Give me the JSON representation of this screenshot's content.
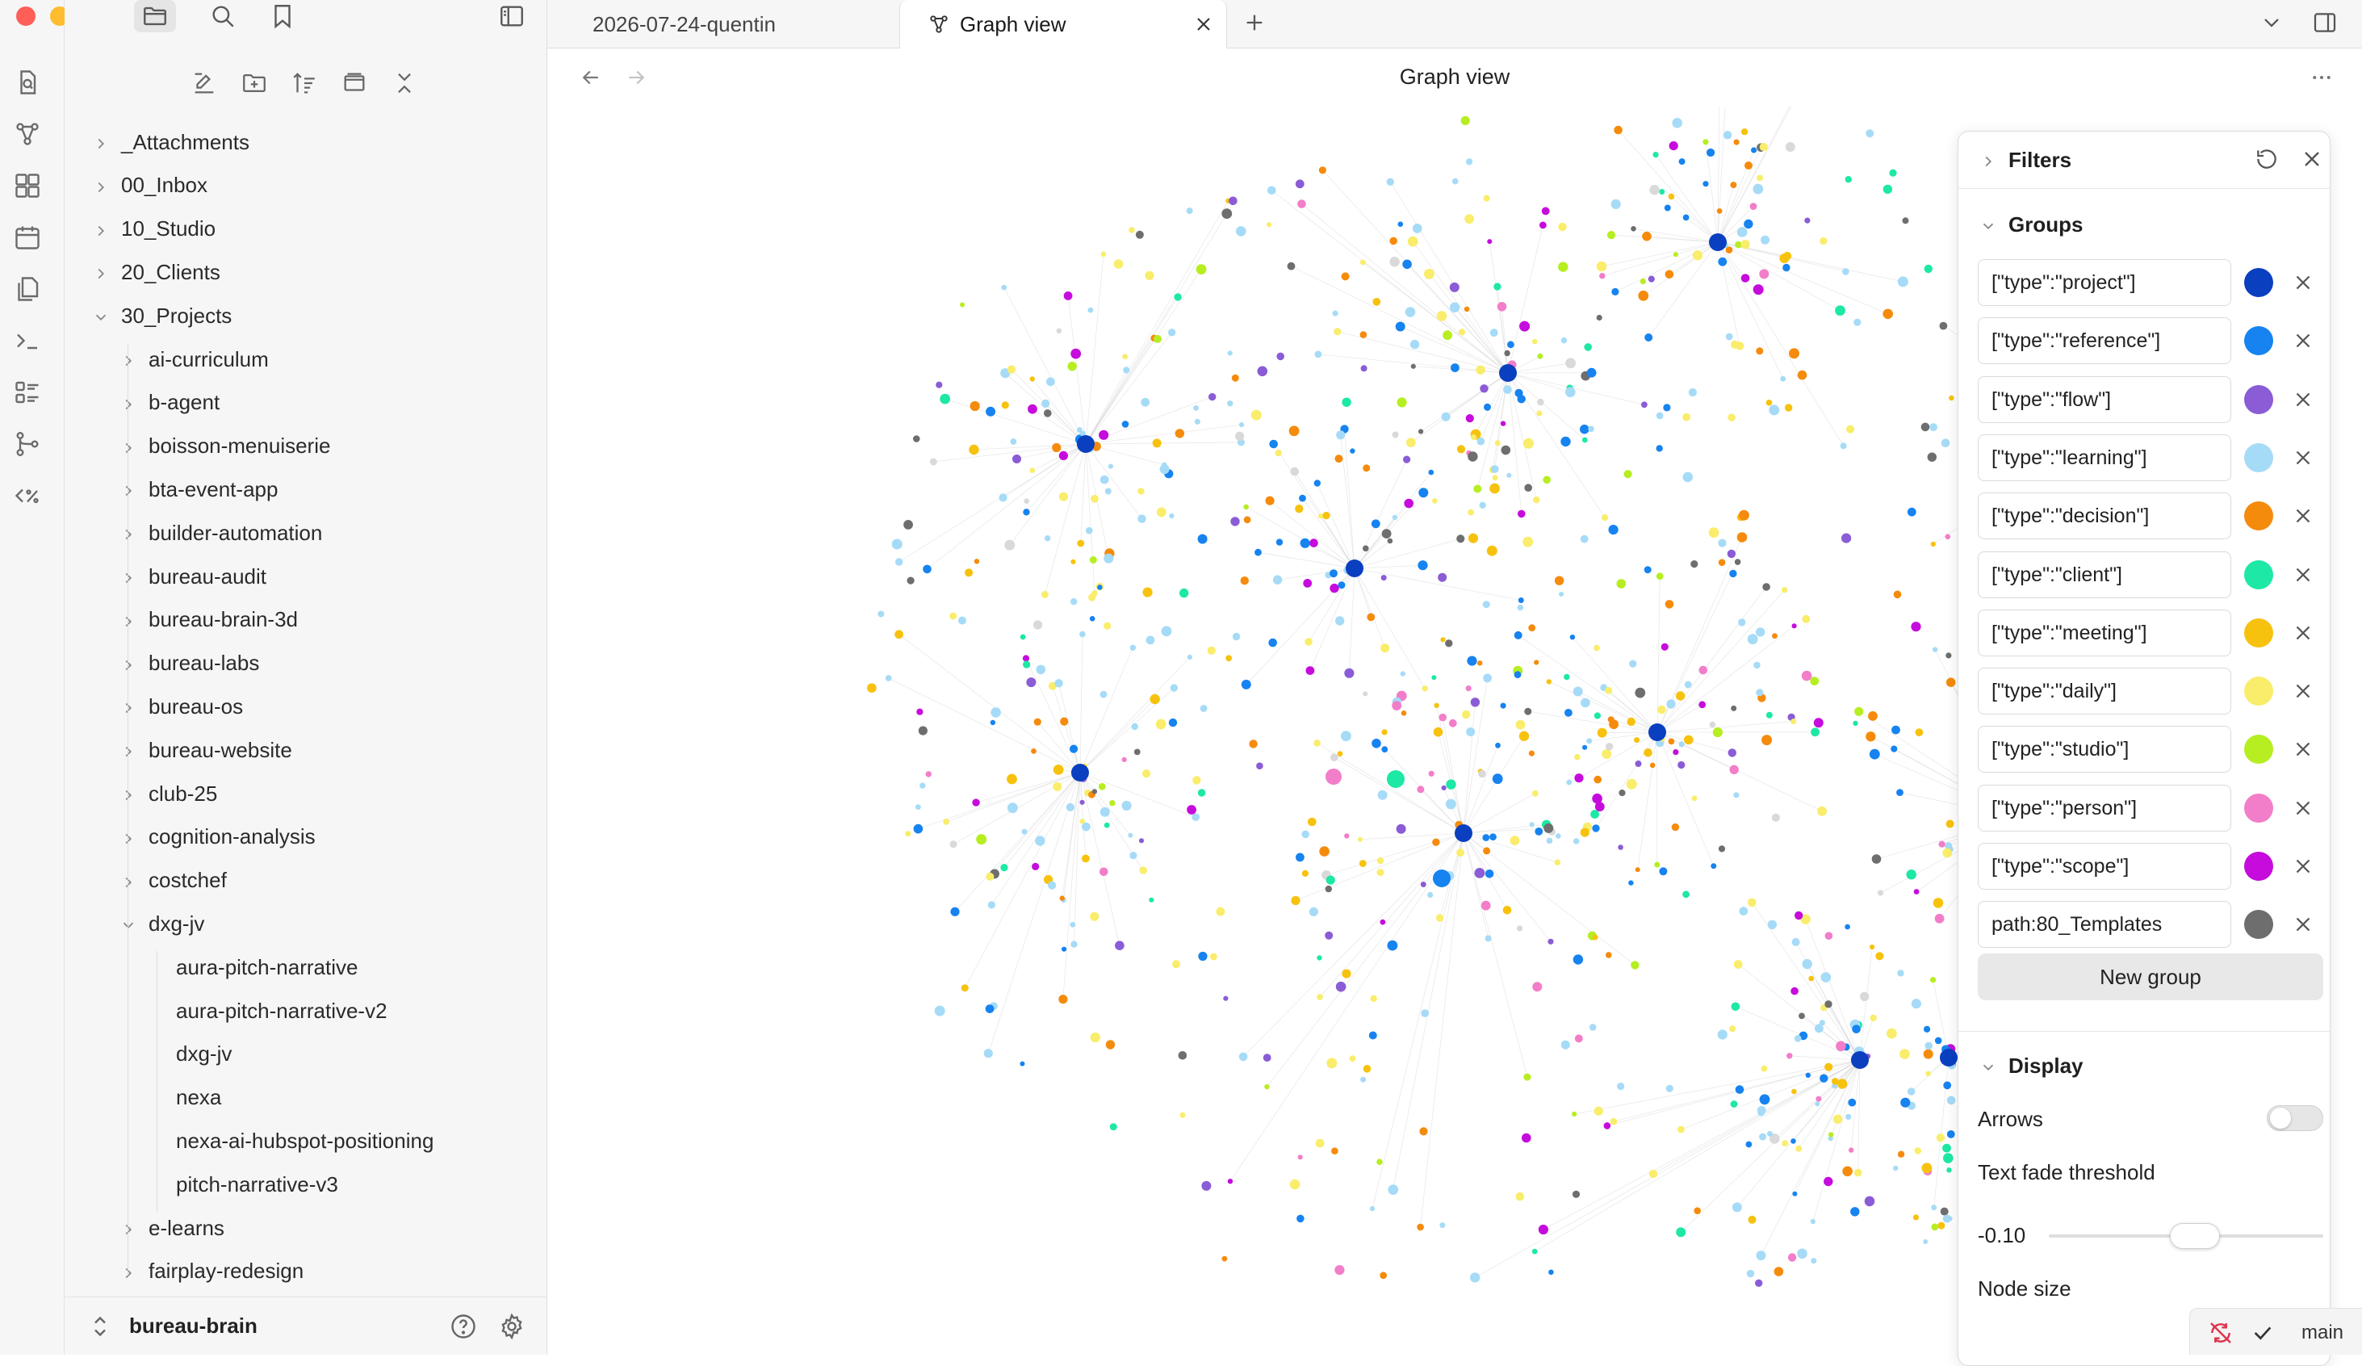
{
  "window": {
    "traffic_colors": [
      "#ff5f57",
      "#febc2e",
      "#28c840"
    ]
  },
  "ribbon": {
    "icons": [
      "search-notes-icon",
      "graph-icon",
      "canvas-icon",
      "calendar-icon",
      "files-icon",
      "command-palette-icon",
      "kanban-icon",
      "git-icon",
      "templater-icon"
    ]
  },
  "sidebar": {
    "top_icons": [
      "folder-icon",
      "search-icon",
      "bookmark-icon"
    ],
    "tools": [
      "new-note-icon",
      "new-folder-icon",
      "sort-icon",
      "collapse-view-icon",
      "collapse-all-icon"
    ],
    "tree": [
      {
        "label": "_Attachments",
        "level": 0,
        "state": "collapsed"
      },
      {
        "label": "00_Inbox",
        "level": 0,
        "state": "collapsed"
      },
      {
        "label": "10_Studio",
        "level": 0,
        "state": "collapsed"
      },
      {
        "label": "20_Clients",
        "level": 0,
        "state": "collapsed"
      },
      {
        "label": "30_Projects",
        "level": 0,
        "state": "expanded"
      },
      {
        "label": "ai-curriculum",
        "level": 1,
        "state": "collapsed"
      },
      {
        "label": "b-agent",
        "level": 1,
        "state": "collapsed"
      },
      {
        "label": "boisson-menuiserie",
        "level": 1,
        "state": "collapsed"
      },
      {
        "label": "bta-event-app",
        "level": 1,
        "state": "collapsed"
      },
      {
        "label": "builder-automation",
        "level": 1,
        "state": "collapsed"
      },
      {
        "label": "bureau-audit",
        "level": 1,
        "state": "collapsed"
      },
      {
        "label": "bureau-brain-3d",
        "level": 1,
        "state": "collapsed"
      },
      {
        "label": "bureau-labs",
        "level": 1,
        "state": "collapsed"
      },
      {
        "label": "bureau-os",
        "level": 1,
        "state": "collapsed"
      },
      {
        "label": "bureau-website",
        "level": 1,
        "state": "collapsed"
      },
      {
        "label": "club-25",
        "level": 1,
        "state": "collapsed"
      },
      {
        "label": "cognition-analysis",
        "level": 1,
        "state": "collapsed"
      },
      {
        "label": "costchef",
        "level": 1,
        "state": "collapsed"
      },
      {
        "label": "dxg-jv",
        "level": 1,
        "state": "expanded"
      },
      {
        "label": "aura-pitch-narrative",
        "level": 2,
        "state": "file"
      },
      {
        "label": "aura-pitch-narrative-v2",
        "level": 2,
        "state": "file"
      },
      {
        "label": "dxg-jv",
        "level": 2,
        "state": "file"
      },
      {
        "label": "nexa",
        "level": 2,
        "state": "file"
      },
      {
        "label": "nexa-ai-hubspot-positioning",
        "level": 2,
        "state": "file"
      },
      {
        "label": "pitch-narrative-v3",
        "level": 2,
        "state": "file"
      },
      {
        "label": "e-learns",
        "level": 1,
        "state": "collapsed"
      },
      {
        "label": "fairplay-redesign",
        "level": 1,
        "state": "collapsed"
      }
    ],
    "vault_name": "bureau-brain"
  },
  "tabs": [
    {
      "label": "2026-07-24-quentin",
      "active": false
    },
    {
      "label": "Graph view",
      "active": true
    }
  ],
  "view": {
    "title": "Graph view"
  },
  "filters": {
    "filters_label": "Filters",
    "groups_label": "Groups",
    "groups": [
      {
        "query": "[\"type\":\"project\"]",
        "color": "#0a3fbf"
      },
      {
        "query": "[\"type\":\"reference\"]",
        "color": "#1683f0"
      },
      {
        "query": "[\"type\":\"flow\"]",
        "color": "#8a5cd6"
      },
      {
        "query": "[\"type\":\"learning\"]",
        "color": "#a6dbf7"
      },
      {
        "query": "[\"type\":\"decision\"]",
        "color": "#f58b0c"
      },
      {
        "query": "[\"type\":\"client\"]",
        "color": "#1de8a5"
      },
      {
        "query": "[\"type\":\"meeting\"]",
        "color": "#f7c20e"
      },
      {
        "query": "[\"type\":\"daily\"]",
        "color": "#f9ed6b"
      },
      {
        "query": "[\"type\":\"studio\"]",
        "color": "#b6ee22"
      },
      {
        "query": "[\"type\":\"person\"]",
        "color": "#f27ec9"
      },
      {
        "query": "[\"type\":\"scope\"]",
        "color": "#c60bdd"
      },
      {
        "query": "path:80_Templates",
        "color": "#6e6e6e"
      }
    ],
    "new_group_label": "New group",
    "display_label": "Display",
    "arrows_label": "Arrows",
    "arrows_on": false,
    "text_fade_label": "Text fade threshold",
    "text_fade_value": "-0.10",
    "node_size_label": "Node size"
  },
  "status": {
    "branch": "main"
  }
}
